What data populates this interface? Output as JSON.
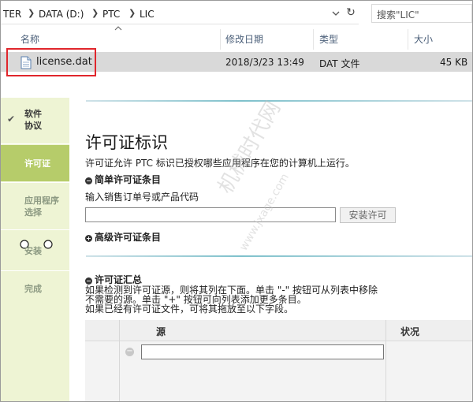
{
  "explorer": {
    "breadcrumb": [
      "TER",
      "DATA (D:)",
      "PTC",
      "LIC"
    ],
    "search_placeholder": "搜索\"LIC\"",
    "columns": {
      "name": "名称",
      "modified": "修改日期",
      "type": "类型",
      "size": "大小"
    },
    "file": {
      "name": "license.dat",
      "modified": "2018/3/23 13:49",
      "type": "DAT 文件",
      "size": "45 KB"
    }
  },
  "installer": {
    "steps": [
      {
        "label": "软件\n协议",
        "state": "done"
      },
      {
        "label": "许可证",
        "state": "active"
      },
      {
        "label": "应用程序\n选择",
        "state": "todo"
      },
      {
        "label": "安装",
        "state": "todo"
      },
      {
        "label": "完成",
        "state": "todo"
      }
    ],
    "title": "许可证标识",
    "description": "许可证允许 PTC 标识已授权哪些应用程序在您的计算机上运行。",
    "simple_section": "简单许可证条目",
    "simple_prompt": "输入销售订单号或产品代码",
    "install_button": "安装许可",
    "advanced_section": "高级许可证条目",
    "summary_section": "许可证汇总",
    "summary_lines": [
      "如果检测到许可证源，则将其列在下面。单击 \"-\" 按钮可从列表中移除",
      "不需要的源。单击 \"+\" 按钮可向列表添加更多条目。",
      "如果已经有许可证文件，可将其拖放至以下字段。"
    ],
    "table_headers": {
      "source": "源",
      "status": "状况"
    }
  },
  "watermark": {
    "line1": "机械时代网",
    "line2": "www.jxage.com"
  },
  "colors": {
    "highlight_box": "#e0262c",
    "active_step": "#b6cc6a",
    "sidebar": "#eef4d4"
  }
}
